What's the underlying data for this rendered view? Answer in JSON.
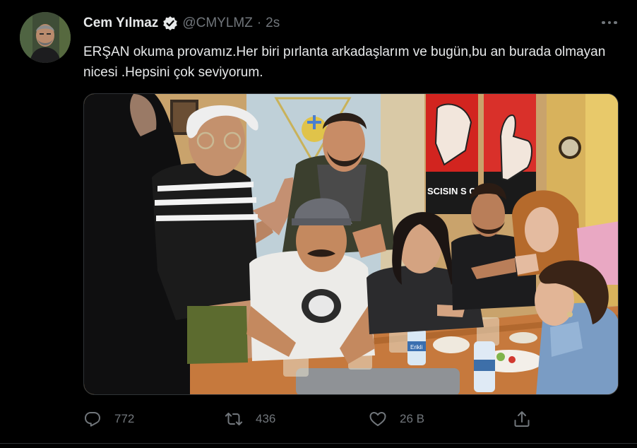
{
  "tweet": {
    "author_name": "Cem Yılmaz",
    "verified_icon": "verified-badge-icon",
    "handle": "@CMYLMZ",
    "separator": "·",
    "time": "2s",
    "text": "ERŞAN okuma provamız.Her biri pırlanta arkadaşlarım ve bugün,bu an burada olmayan nicesi .Hepsini çok seviyorum.",
    "media": {
      "poster_text": "SCISIN S        ÇI K",
      "water_bottle_label": "Erikli"
    }
  },
  "actions": {
    "reply": {
      "icon": "reply-icon",
      "count": "772"
    },
    "retweet": {
      "icon": "retweet-icon",
      "count": "436"
    },
    "like": {
      "icon": "like-icon",
      "count": "26 B"
    },
    "share": {
      "icon": "share-icon"
    }
  },
  "colors": {
    "background": "#000000",
    "text_primary": "#e7e9ea",
    "text_secondary": "#71767b",
    "border": "#2f3336",
    "verified_badge": "#e7e9ea"
  }
}
